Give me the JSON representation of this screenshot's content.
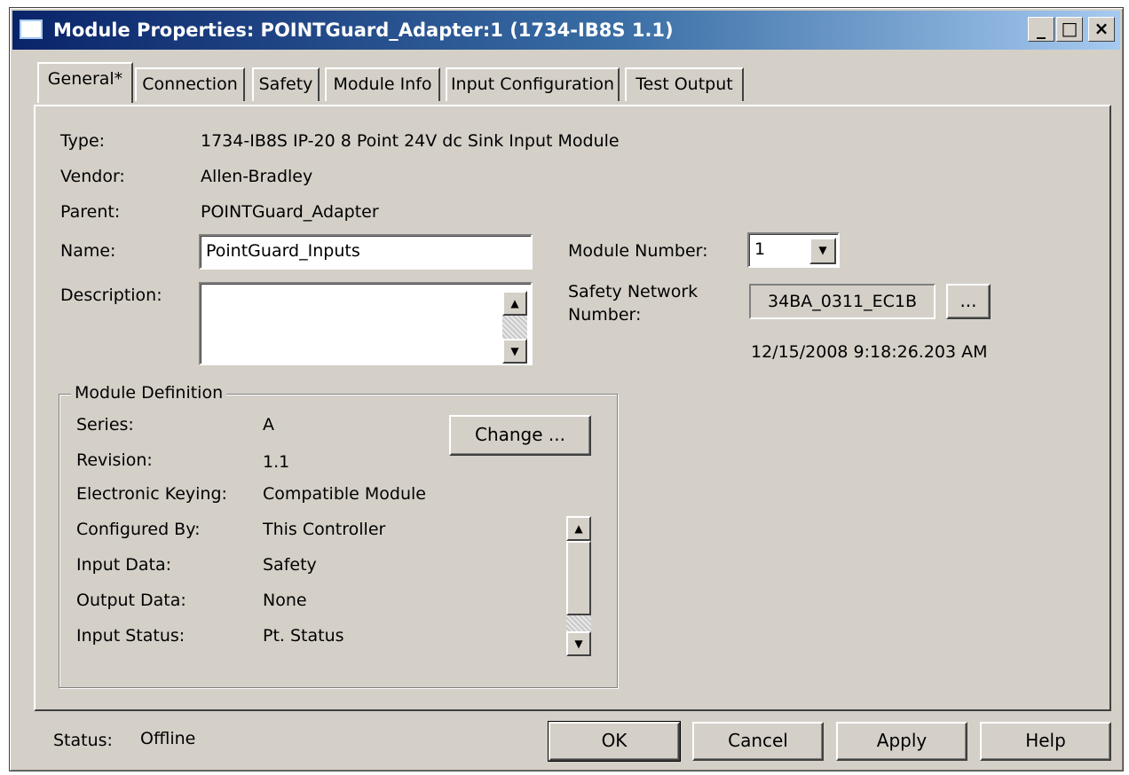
{
  "window": {
    "title": "Module Properties: POINTGuard_Adapter:1 (1734-IB8S 1.1)",
    "controls": {
      "minimize": "_",
      "maximize": "□",
      "close": "×"
    }
  },
  "tabs": [
    "General*",
    "Connection",
    "Safety",
    "Module Info",
    "Input Configuration",
    "Test Output"
  ],
  "general": {
    "type_label": "Type:",
    "type_value": "1734-IB8S IP-20 8 Point 24V dc Sink Input Module",
    "vendor_label": "Vendor:",
    "vendor_value": "Allen-Bradley",
    "parent_label": "Parent:",
    "parent_value": "POINTGuard_Adapter",
    "name_label": "Name:",
    "name_value": "PointGuard_Inputs",
    "description_label": "Description:",
    "description_value": "",
    "module_number_label": "Module Number:",
    "module_number_value": "1",
    "safety_network_label_line1": "Safety Network",
    "safety_network_label_line2": "Number:",
    "safety_network_value": "34BA_0311_EC1B",
    "safety_network_button": "...",
    "safety_network_timestamp": "12/15/2008 9:18:26.203 AM"
  },
  "module_definition": {
    "title": "Module Definition",
    "change_button": "Change ...",
    "rows": [
      {
        "label": "Series:",
        "value": "A"
      },
      {
        "label": "Revision:",
        "value": "1.1"
      },
      {
        "label": "Electronic Keying:",
        "value": "Compatible Module"
      },
      {
        "label": "Configured By:",
        "value": "This Controller"
      },
      {
        "label": "Input Data:",
        "value": "Safety"
      },
      {
        "label": "Output Data:",
        "value": "None"
      },
      {
        "label": "Input Status:",
        "value": "Pt. Status"
      }
    ]
  },
  "status": {
    "label": "Status:",
    "value": "Offline"
  },
  "buttons": {
    "ok": "OK",
    "cancel": "Cancel",
    "apply": "Apply",
    "help": "Help"
  }
}
